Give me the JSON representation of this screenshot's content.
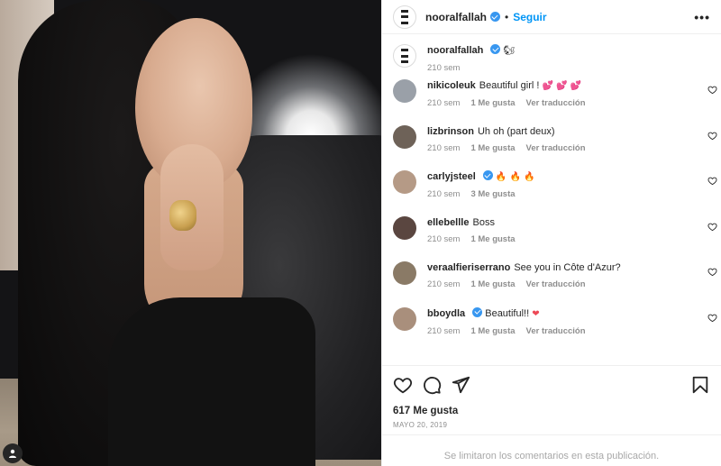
{
  "post": {
    "username": "nooralfallah",
    "follow_label": "Seguir",
    "more_label": "•••",
    "separator": "•",
    "caption_emoji": "🐿",
    "caption_time": "210 sem",
    "likes": "617 Me gusta",
    "date": "MAYO 20, 2019",
    "comments_limited": "Se limitaron los comentarios en esta publicación."
  },
  "comments": [
    {
      "username": "nikicoleuk",
      "text": "Beautiful girl ! ",
      "emoji": "💕 💕 💕",
      "time": "210 sem",
      "likes": "1 Me gusta",
      "translate": "Ver traducción",
      "avatar_color": "#9aa0a8",
      "verified": false
    },
    {
      "username": "lizbrinson",
      "text": "Uh oh (part deux)",
      "emoji": "",
      "time": "210 sem",
      "likes": "1 Me gusta",
      "translate": "Ver traducción",
      "avatar_color": "#6e6258",
      "verified": false
    },
    {
      "username": "carlyjsteel",
      "text": "",
      "emoji": "🔥 🔥 🔥",
      "time": "210 sem",
      "likes": "3 Me gusta",
      "translate": "",
      "avatar_color": "#b59a86",
      "verified": true
    },
    {
      "username": "ellebellle",
      "text": "Boss",
      "emoji": "",
      "time": "210 sem",
      "likes": "1 Me gusta",
      "translate": "",
      "avatar_color": "#5a4640",
      "verified": false
    },
    {
      "username": "veraalfieriserrano",
      "text": "See you in Côte d'Azur?",
      "emoji": "",
      "time": "210 sem",
      "likes": "1 Me gusta",
      "translate": "Ver traducción",
      "avatar_color": "#8a7a66",
      "verified": false
    },
    {
      "username": "bboydla",
      "text": "Beautiful!! ",
      "emoji": "❤",
      "time": "210 sem",
      "likes": "1 Me gusta",
      "translate": "Ver traducción",
      "avatar_color": "#a98f7c",
      "verified": true
    }
  ],
  "colors": {
    "accent": "#0095f6",
    "verified": "#3897f0",
    "muted": "#8e8e8e",
    "heart": "#ed4956"
  },
  "icons": [
    "like-heart-icon",
    "comment-icon",
    "share-icon",
    "save-bookmark-icon",
    "more-options-icon",
    "verified-badge-icon",
    "user-tag-icon"
  ]
}
